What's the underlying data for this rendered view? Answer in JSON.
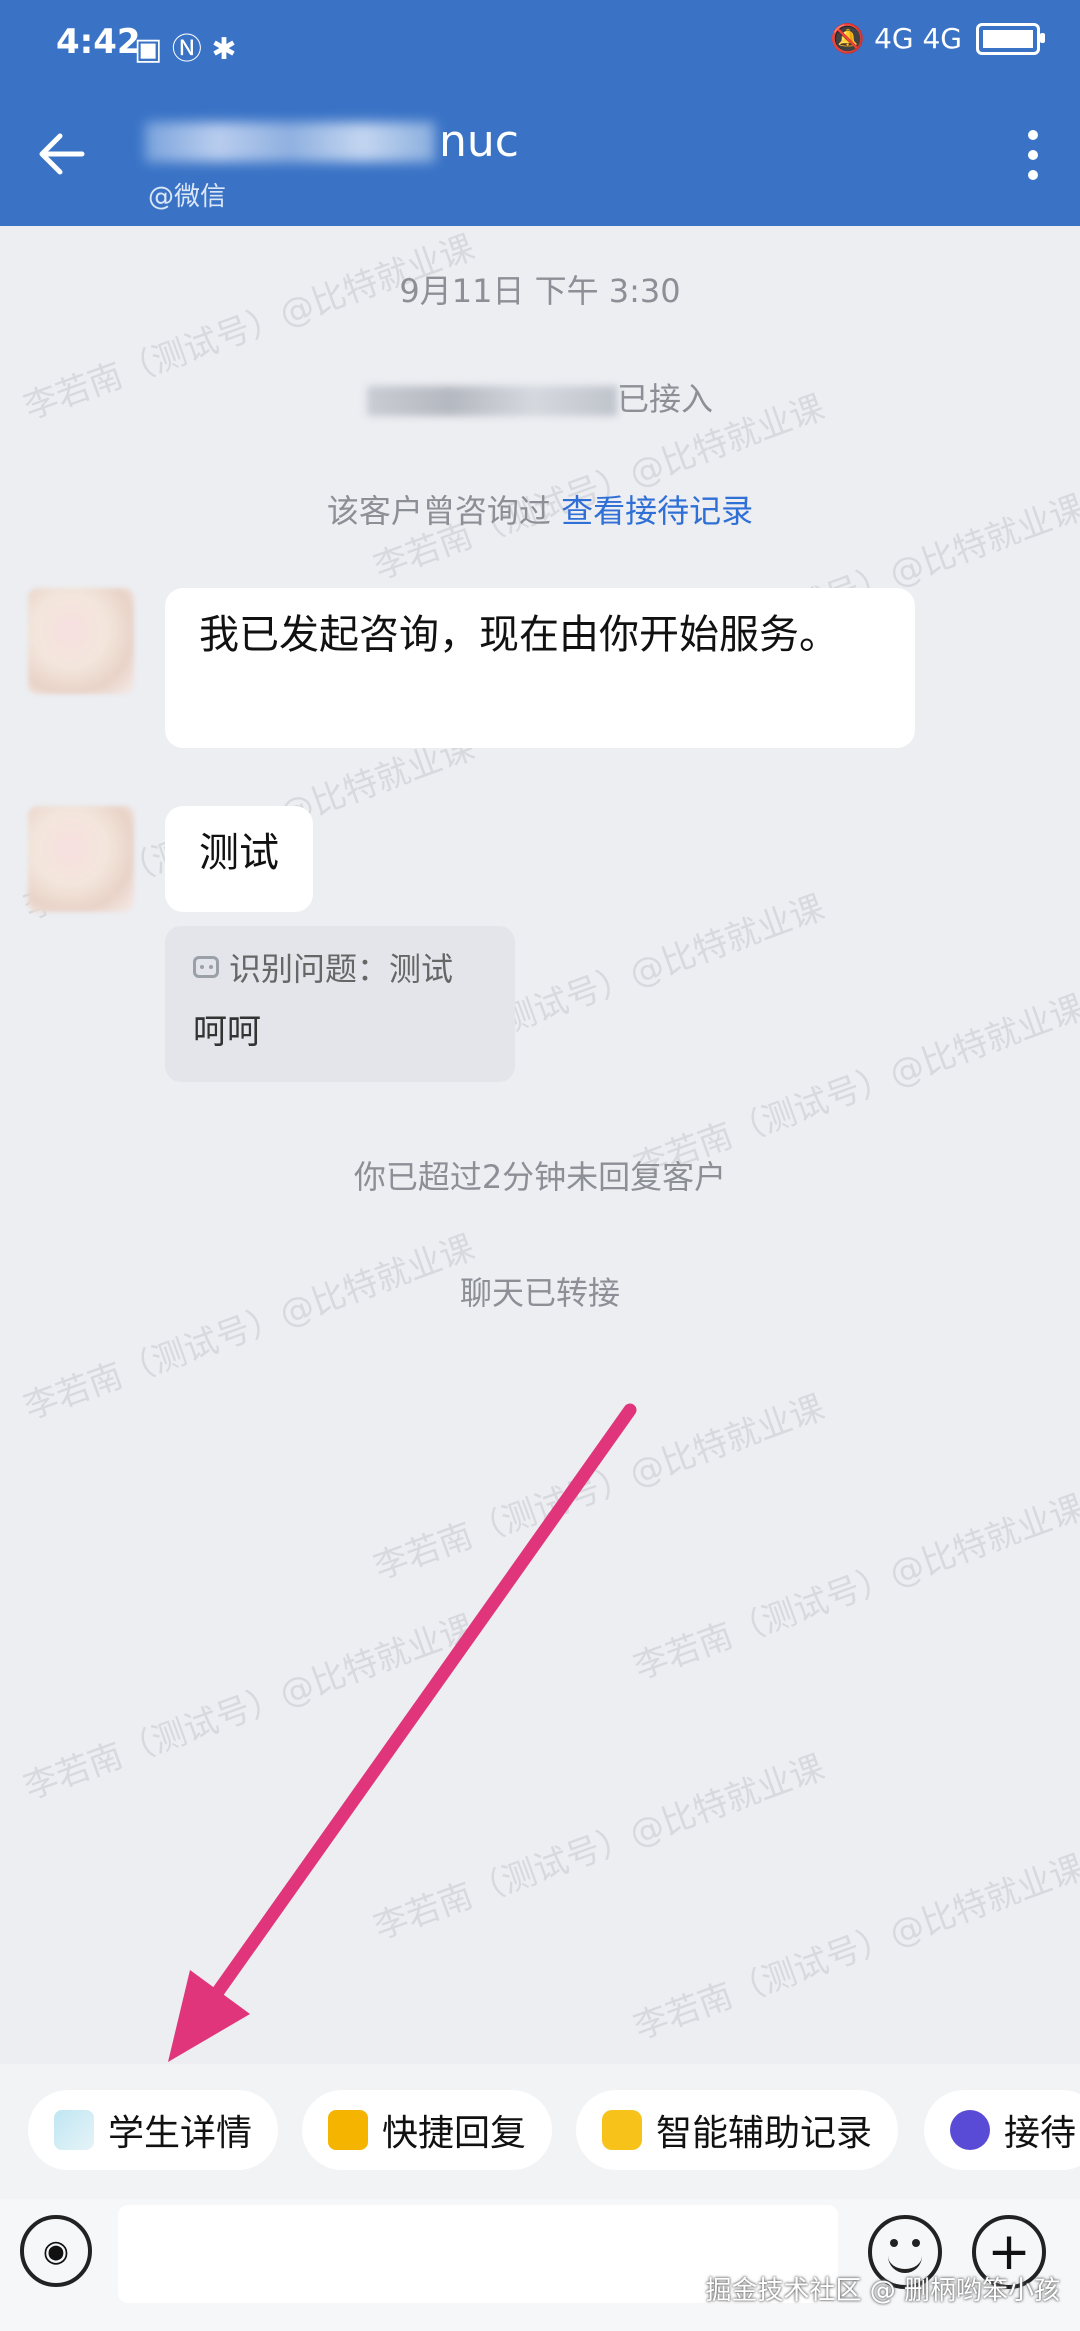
{
  "status_bar": {
    "time": "4:42",
    "left_icons": "▣ Ⓝ ✱",
    "right_icons": "🔕 4G 4G"
  },
  "header": {
    "title_suffix": "nuc",
    "subtitle": "@微信"
  },
  "watermark": "李若南（测试号）@比特就业课",
  "chat": {
    "timestamp": "9月11日  下午 3:30",
    "joined_suffix": "已接入",
    "history_prefix": "该客户曾咨询过 ",
    "history_link": "查看接待记录",
    "message1": "我已发起咨询，现在由你开始服务。",
    "message2": "测试",
    "card_label": "识别问题：测试",
    "card_reply": "呵呵",
    "timeout_note": "你已超过2分钟未回复客户",
    "transfer_note": "聊天已转接"
  },
  "quick_actions": [
    {
      "label": "学生详情",
      "icon": "student-info-icon"
    },
    {
      "label": "快捷回复",
      "icon": "quick-reply-icon"
    },
    {
      "label": "智能辅助记录",
      "icon": "ai-assistant-icon"
    },
    {
      "label": "接待",
      "icon": "reception-icon"
    }
  ],
  "footer_watermark": "掘金技术社区 @ 删柄哟笨小孩",
  "colors": {
    "header": "#3a73c6",
    "link": "#2f6fd6",
    "arrow": "#e0357a"
  }
}
